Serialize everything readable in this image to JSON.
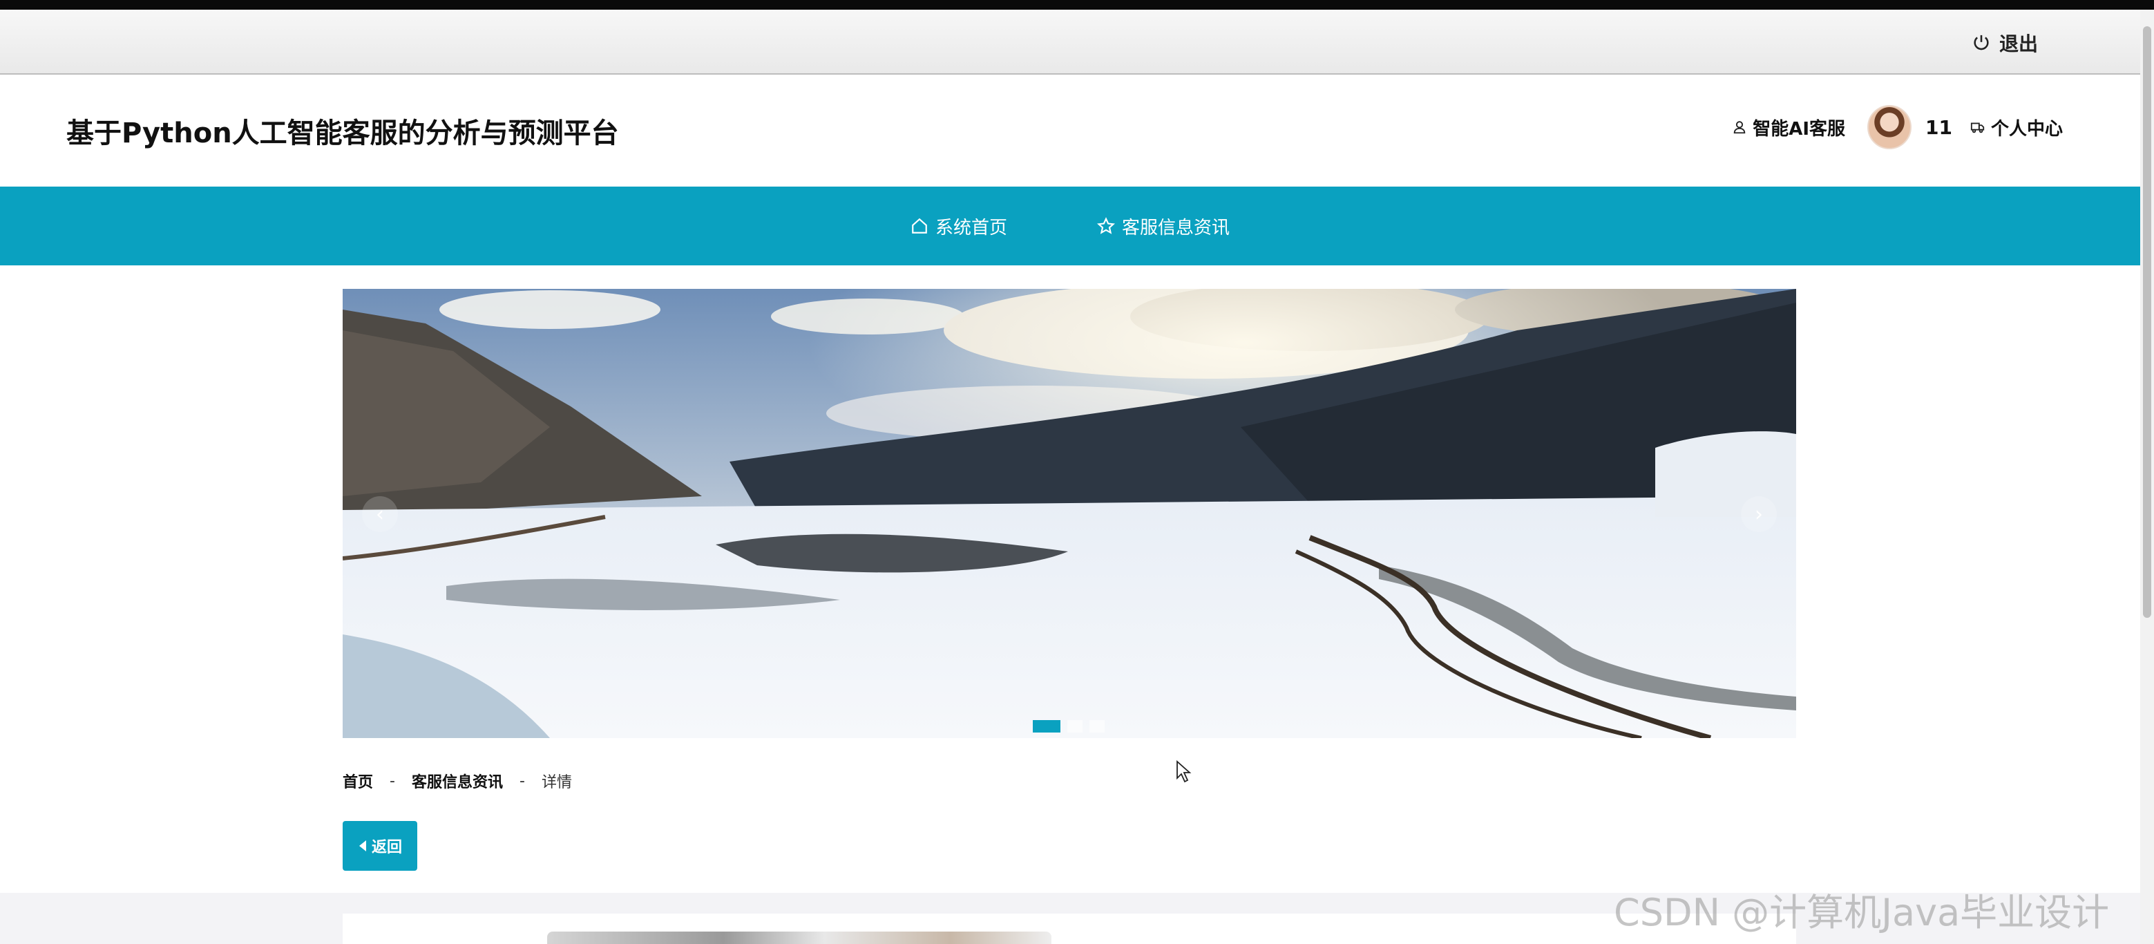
{
  "topbar": {
    "logout_label": "退出"
  },
  "header": {
    "site_title": "基于Python人工智能客服的分析与预测平台",
    "ai_service_label": "智能AI客服",
    "username": "11",
    "user_center_label": "个人中心"
  },
  "nav": {
    "items": [
      {
        "label": "系统首页",
        "icon": "home-icon"
      },
      {
        "label": "客服信息资讯",
        "icon": "star-icon"
      }
    ]
  },
  "banner": {
    "prev_label": "‹",
    "next_label": "›",
    "slide_count": 3,
    "active_slide": 1
  },
  "breadcrumb": {
    "home": "首页",
    "separator": "-",
    "section": "客服信息资讯",
    "current": "详情"
  },
  "back_button": {
    "label": "返回"
  },
  "watermark": "CSDN @计算机Java毕业设计",
  "colors": {
    "accent": "#0aa1c0",
    "topbar": "#efefef"
  }
}
